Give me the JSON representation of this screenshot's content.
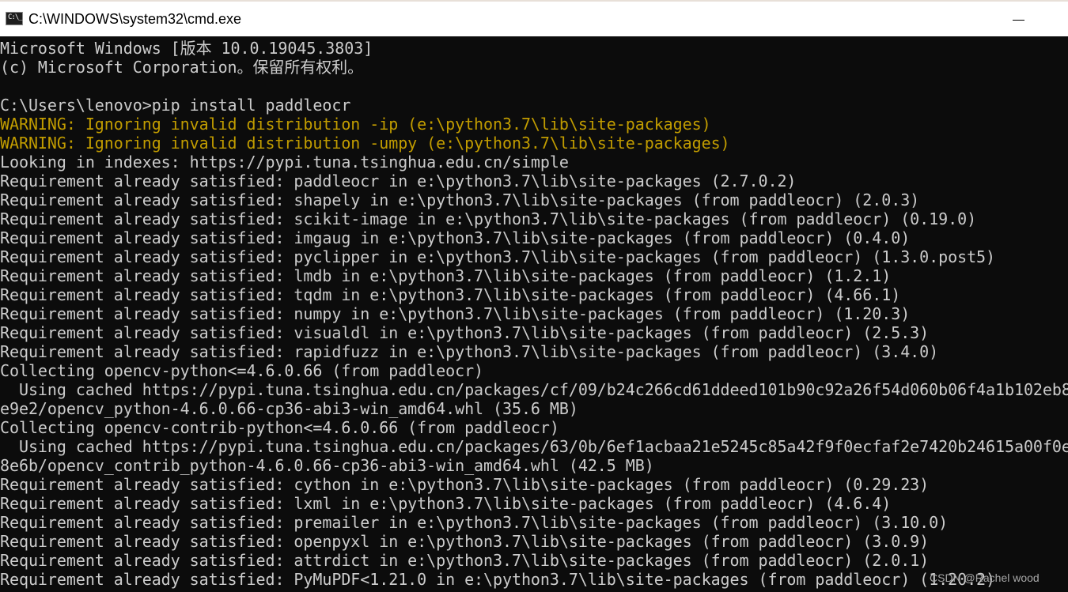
{
  "window": {
    "title": "C:\\WINDOWS\\system32\\cmd.exe",
    "icon": "cmd-icon",
    "icon_glyph": "C:\\_",
    "minimize_icon": "minimize-icon"
  },
  "colors": {
    "background": "#0c0c0c",
    "text": "#cccccc",
    "warning": "#c19c00",
    "titlebar": "#ffffff"
  },
  "console": {
    "lines": [
      {
        "text": "Microsoft Windows [版本 10.0.19045.3803]",
        "type": "normal"
      },
      {
        "text": "(c) Microsoft Corporation。保留所有权利。",
        "type": "normal"
      },
      {
        "text": "",
        "type": "normal"
      },
      {
        "text": "C:\\Users\\lenovo>pip install paddleocr",
        "type": "normal"
      },
      {
        "text": "WARNING: Ignoring invalid distribution -ip (e:\\python3.7\\lib\\site-packages)",
        "type": "warning"
      },
      {
        "text": "WARNING: Ignoring invalid distribution -umpy (e:\\python3.7\\lib\\site-packages)",
        "type": "warning"
      },
      {
        "text": "Looking in indexes: https://pypi.tuna.tsinghua.edu.cn/simple",
        "type": "normal"
      },
      {
        "text": "Requirement already satisfied: paddleocr in e:\\python3.7\\lib\\site-packages (2.7.0.2)",
        "type": "normal"
      },
      {
        "text": "Requirement already satisfied: shapely in e:\\python3.7\\lib\\site-packages (from paddleocr) (2.0.3)",
        "type": "normal"
      },
      {
        "text": "Requirement already satisfied: scikit-image in e:\\python3.7\\lib\\site-packages (from paddleocr) (0.19.0)",
        "type": "normal"
      },
      {
        "text": "Requirement already satisfied: imgaug in e:\\python3.7\\lib\\site-packages (from paddleocr) (0.4.0)",
        "type": "normal"
      },
      {
        "text": "Requirement already satisfied: pyclipper in e:\\python3.7\\lib\\site-packages (from paddleocr) (1.3.0.post5)",
        "type": "normal"
      },
      {
        "text": "Requirement already satisfied: lmdb in e:\\python3.7\\lib\\site-packages (from paddleocr) (1.2.1)",
        "type": "normal"
      },
      {
        "text": "Requirement already satisfied: tqdm in e:\\python3.7\\lib\\site-packages (from paddleocr) (4.66.1)",
        "type": "normal"
      },
      {
        "text": "Requirement already satisfied: numpy in e:\\python3.7\\lib\\site-packages (from paddleocr) (1.20.3)",
        "type": "normal"
      },
      {
        "text": "Requirement already satisfied: visualdl in e:\\python3.7\\lib\\site-packages (from paddleocr) (2.5.3)",
        "type": "normal"
      },
      {
        "text": "Requirement already satisfied: rapidfuzz in e:\\python3.7\\lib\\site-packages (from paddleocr) (3.4.0)",
        "type": "normal"
      },
      {
        "text": "Collecting opencv-python<=4.6.0.66 (from paddleocr)",
        "type": "normal"
      },
      {
        "text": "  Using cached https://pypi.tuna.tsinghua.edu.cn/packages/cf/09/b24c266cd61ddeed101b90c92a26f54d060b06f4a1b102eb8",
        "type": "normal"
      },
      {
        "text": "e9e2/opencv_python-4.6.0.66-cp36-abi3-win_amd64.whl (35.6 MB)",
        "type": "normal"
      },
      {
        "text": "Collecting opencv-contrib-python<=4.6.0.66 (from paddleocr)",
        "type": "normal"
      },
      {
        "text": "  Using cached https://pypi.tuna.tsinghua.edu.cn/packages/63/0b/6ef1acbaa21e5245c85a42f9f0ecfaf2e7420b24615a00f0e",
        "type": "normal"
      },
      {
        "text": "8e6b/opencv_contrib_python-4.6.0.66-cp36-abi3-win_amd64.whl (42.5 MB)",
        "type": "normal"
      },
      {
        "text": "Requirement already satisfied: cython in e:\\python3.7\\lib\\site-packages (from paddleocr) (0.29.23)",
        "type": "normal"
      },
      {
        "text": "Requirement already satisfied: lxml in e:\\python3.7\\lib\\site-packages (from paddleocr) (4.6.4)",
        "type": "normal"
      },
      {
        "text": "Requirement already satisfied: premailer in e:\\python3.7\\lib\\site-packages (from paddleocr) (3.10.0)",
        "type": "normal"
      },
      {
        "text": "Requirement already satisfied: openpyxl in e:\\python3.7\\lib\\site-packages (from paddleocr) (3.0.9)",
        "type": "normal"
      },
      {
        "text": "Requirement already satisfied: attrdict in e:\\python3.7\\lib\\site-packages (from paddleocr) (2.0.1)",
        "type": "normal"
      },
      {
        "text": "Requirement already satisfied: PyMuPDF<1.21.0 in e:\\python3.7\\lib\\site-packages (from paddleocr) (1.20.2)",
        "type": "normal"
      }
    ]
  },
  "watermark": "CSDN @Rachel wood"
}
